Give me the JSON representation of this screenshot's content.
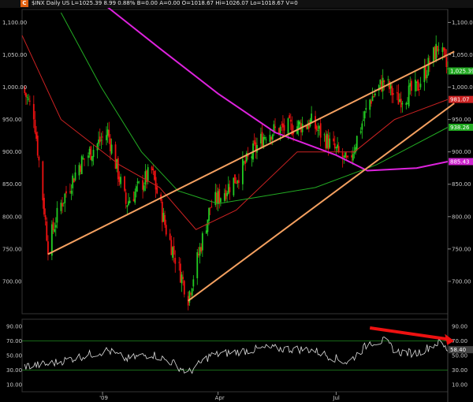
{
  "header": {
    "symbol_badge": "C",
    "quote": "$INX  Daily US  L=1025.39  8.99  0.88%  B=0.00  A=0.00  O=1018.67  Hi=1026.07  Lo=1018.67  V=0"
  },
  "colors": {
    "up": "#22cc22",
    "down": "#ee1111",
    "ma_short": "#cc2222",
    "ma_mid": "#22aa22",
    "ma_long": "#dd22dd",
    "trendline": "#f4a060",
    "rsi_line": "#dddddd",
    "arrow": "#ee1111",
    "price_tag": "#22aa22",
    "ma_tag_red": "#cc2222",
    "ma_tag_green": "#22aa22",
    "ma_tag_magenta": "#cc22cc"
  },
  "chart_data": {
    "type": "candlestick",
    "title": "$INX Daily US",
    "x_axis": {
      "tick_labels": [
        "'09",
        "Apr",
        "Jul"
      ],
      "start_date": "2008-11-01",
      "end_date": "2009-09-25",
      "tick_dates": [
        "2009-01-02",
        "2009-04-01",
        "2009-07-01"
      ]
    },
    "price_axis": {
      "range": [
        650,
        1120
      ],
      "tick_values": [
        700,
        750,
        800,
        850,
        900,
        950,
        1000,
        1050,
        1100
      ],
      "tick_labels": [
        "700.00",
        "750.00",
        "800.00",
        "850.00",
        "900.00",
        "950.00",
        "1,000.00",
        "1,050.00",
        "1,100.00"
      ]
    },
    "price_path": {
      "description": "approximate daily close path (date, close)",
      "points": [
        [
          "2008-11-01",
          1000
        ],
        [
          "2008-11-10",
          960
        ],
        [
          "2008-11-21",
          755
        ],
        [
          "2008-12-01",
          820
        ],
        [
          "2008-12-15",
          880
        ],
        [
          "2009-01-06",
          930
        ],
        [
          "2009-01-20",
          820
        ],
        [
          "2009-02-09",
          870
        ],
        [
          "2009-02-20",
          780
        ],
        [
          "2009-03-09",
          676
        ],
        [
          "2009-03-26",
          815
        ],
        [
          "2009-04-15",
          860
        ],
        [
          "2009-05-08",
          930
        ],
        [
          "2009-06-12",
          945
        ],
        [
          "2009-07-10",
          880
        ],
        [
          "2009-07-27",
          980
        ],
        [
          "2009-08-07",
          1010
        ],
        [
          "2009-08-17",
          980
        ],
        [
          "2009-09-01",
          998
        ],
        [
          "2009-09-18",
          1065
        ],
        [
          "2009-09-25",
          1025
        ]
      ]
    },
    "moving_averages": [
      {
        "color_key": "ma_short",
        "tag_label": "981.07",
        "points": [
          [
            "2008-11-01",
            1080
          ],
          [
            "2008-12-01",
            950
          ],
          [
            "2009-01-15",
            880
          ],
          [
            "2009-02-15",
            845
          ],
          [
            "2009-03-15",
            780
          ],
          [
            "2009-04-15",
            810
          ],
          [
            "2009-06-01",
            900
          ],
          [
            "2009-07-15",
            900
          ],
          [
            "2009-08-15",
            950
          ],
          [
            "2009-09-25",
            981
          ]
        ]
      },
      {
        "color_key": "ma_mid",
        "tag_label": "938.26",
        "points": [
          [
            "2008-12-01",
            1115
          ],
          [
            "2009-01-01",
            1000
          ],
          [
            "2009-02-01",
            900
          ],
          [
            "2009-03-01",
            840
          ],
          [
            "2009-04-01",
            820
          ],
          [
            "2009-05-01",
            830
          ],
          [
            "2009-06-15",
            845
          ],
          [
            "2009-08-01",
            880
          ],
          [
            "2009-09-25",
            938
          ]
        ]
      },
      {
        "color_key": "ma_long",
        "tag_label": "885.43",
        "points": [
          [
            "2009-01-05",
            1125
          ],
          [
            "2009-02-15",
            1060
          ],
          [
            "2009-04-01",
            990
          ],
          [
            "2009-05-15",
            930
          ],
          [
            "2009-07-01",
            895
          ],
          [
            "2009-07-25",
            871
          ],
          [
            "2009-09-01",
            875
          ],
          [
            "2009-09-25",
            885
          ]
        ]
      }
    ],
    "trendlines": [
      {
        "from": [
          "2008-11-21",
          742
        ],
        "to": [
          "2009-09-30",
          1055
        ]
      },
      {
        "from": [
          "2009-03-09",
          670
        ],
        "to": [
          "2009-09-30",
          975
        ]
      }
    ],
    "last_price_tag": "1,025.39",
    "rsi": {
      "range": [
        0,
        100
      ],
      "tick_values": [
        10,
        30,
        50,
        70,
        90
      ],
      "tick_labels": [
        "10.00",
        "30.00",
        "50.00",
        "70.00",
        "90.00"
      ],
      "reference_lines": [
        30,
        70
      ],
      "last_value_tag": "58.40",
      "arrow": {
        "from": [
          "2009-07-27",
          88
        ],
        "to": [
          "2009-09-30",
          70
        ]
      },
      "points": [
        [
          "2008-11-01",
          35
        ],
        [
          "2008-11-21",
          38
        ],
        [
          "2008-12-15",
          48
        ],
        [
          "2009-01-06",
          57
        ],
        [
          "2009-01-20",
          45
        ],
        [
          "2009-02-09",
          52
        ],
        [
          "2009-02-25",
          40
        ],
        [
          "2009-03-09",
          26
        ],
        [
          "2009-03-26",
          50
        ],
        [
          "2009-04-15",
          55
        ],
        [
          "2009-05-08",
          60
        ],
        [
          "2009-06-12",
          58
        ],
        [
          "2009-07-10",
          40
        ],
        [
          "2009-07-27",
          68
        ],
        [
          "2009-08-07",
          70
        ],
        [
          "2009-08-17",
          55
        ],
        [
          "2009-09-01",
          53
        ],
        [
          "2009-09-18",
          68
        ],
        [
          "2009-09-25",
          58
        ]
      ]
    }
  }
}
